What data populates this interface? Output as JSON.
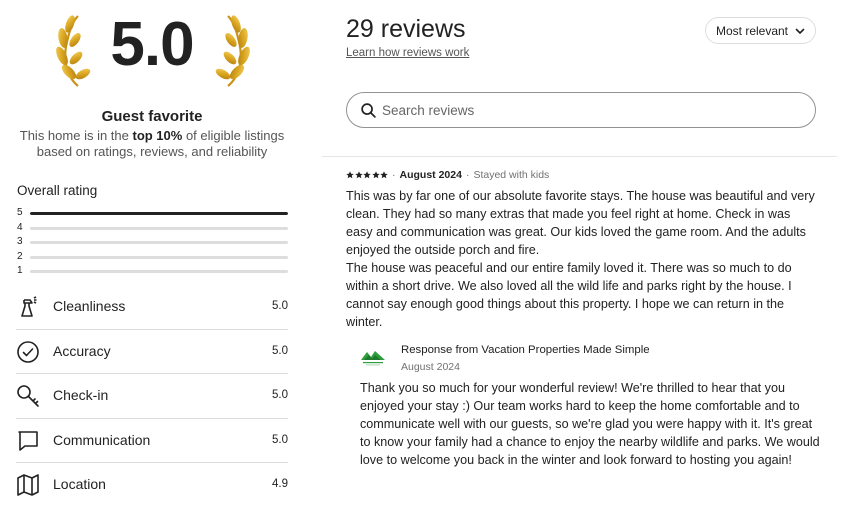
{
  "summary": {
    "score": "5.0",
    "badge_title": "Guest favorite",
    "desc_before": "This home is in the ",
    "desc_bold": "top 10%",
    "desc_after": " of eligible listings based on ratings, reviews, and reliability",
    "laurel_color": "#D9A520"
  },
  "overall": {
    "title": "Overall rating",
    "distribution": [
      {
        "stars": "5",
        "fraction": 1.0
      },
      {
        "stars": "4",
        "fraction": 0.0
      },
      {
        "stars": "3",
        "fraction": 0.0
      },
      {
        "stars": "2",
        "fraction": 0.0
      },
      {
        "stars": "1",
        "fraction": 0.0
      }
    ]
  },
  "categories": [
    {
      "label": "Cleanliness",
      "value": "5.0",
      "icon": "spray-bottle-icon"
    },
    {
      "label": "Accuracy",
      "value": "5.0",
      "icon": "check-circle-icon"
    },
    {
      "label": "Check-in",
      "value": "5.0",
      "icon": "key-icon"
    },
    {
      "label": "Communication",
      "value": "5.0",
      "icon": "message-bubble-icon"
    },
    {
      "label": "Location",
      "value": "4.9",
      "icon": "map-icon"
    }
  ],
  "header": {
    "count": "29 reviews",
    "learn_link": "Learn how reviews work",
    "sort_label": "Most relevant"
  },
  "search": {
    "placeholder": "Search reviews",
    "value": ""
  },
  "review": {
    "rating": 5,
    "date": "August 2024",
    "separator": "·",
    "stayed": "Stayed with kids",
    "text": "This was by far one of our absolute favorite stays. The house was beautiful and very clean. They had so many extras that made you feel right at home. Check in was easy and communication was great. Our kids loved the game room. And the adults enjoyed the outside porch and fire.\nThe house was peaceful and our entire family loved it. There was so much to do within a short drive. We also loved all the wild life and parks right by the house. I cannot say enough good things about this property. I hope we can return in the winter."
  },
  "response": {
    "title": "Response from Vacation Properties Made Simple",
    "date": "August 2024",
    "text": "Thank you so much for your wonderful review! We're thrilled to hear that you enjoyed your stay :) Our team works hard to keep the home comfortable and to communicate well with our guests, so we're glad you were happy with it. It's great to know your family had a chance to enjoy the nearby wildlife and parks. We would love to welcome you back in the winter and look forward to hosting you again!",
    "logo_color": "#2E9E3E"
  }
}
